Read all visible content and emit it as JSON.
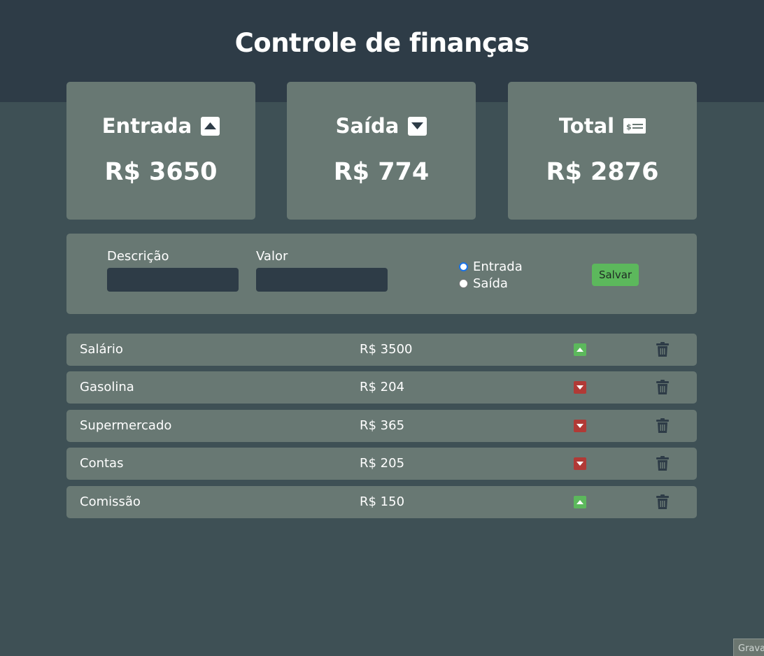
{
  "title": "Controle de finanças",
  "cards": [
    {
      "label": "Entrada",
      "value": "R$ 3650",
      "icon": "caret-up-square-icon"
    },
    {
      "label": "Saída",
      "value": "R$ 774",
      "icon": "caret-down-square-icon"
    },
    {
      "label": "Total",
      "value": "R$ 2876",
      "icon": "money-check-icon"
    }
  ],
  "form": {
    "description_label": "Descrição",
    "description_value": "",
    "value_label": "Valor",
    "value_value": "",
    "radio_entrada": "Entrada",
    "radio_saida": "Saída",
    "selected_type": "Entrada",
    "save_label": "Salvar"
  },
  "transactions": [
    {
      "description": "Salário",
      "value": "R$ 3500",
      "type": "entrada"
    },
    {
      "description": "Gasolina",
      "value": "R$ 204",
      "type": "saida"
    },
    {
      "description": "Supermercado",
      "value": "R$ 365",
      "type": "saida"
    },
    {
      "description": "Contas",
      "value": "R$ 205",
      "type": "saida"
    },
    {
      "description": "Comissão",
      "value": "R$ 150",
      "type": "entrada"
    }
  ],
  "colors": {
    "header": "#2e3c47",
    "background": "#3e5055",
    "panel": "#687873",
    "income": "#5cb85c",
    "expense": "#b13a36",
    "trash": "#2e3c47"
  },
  "corner_tab_text": "Grava"
}
